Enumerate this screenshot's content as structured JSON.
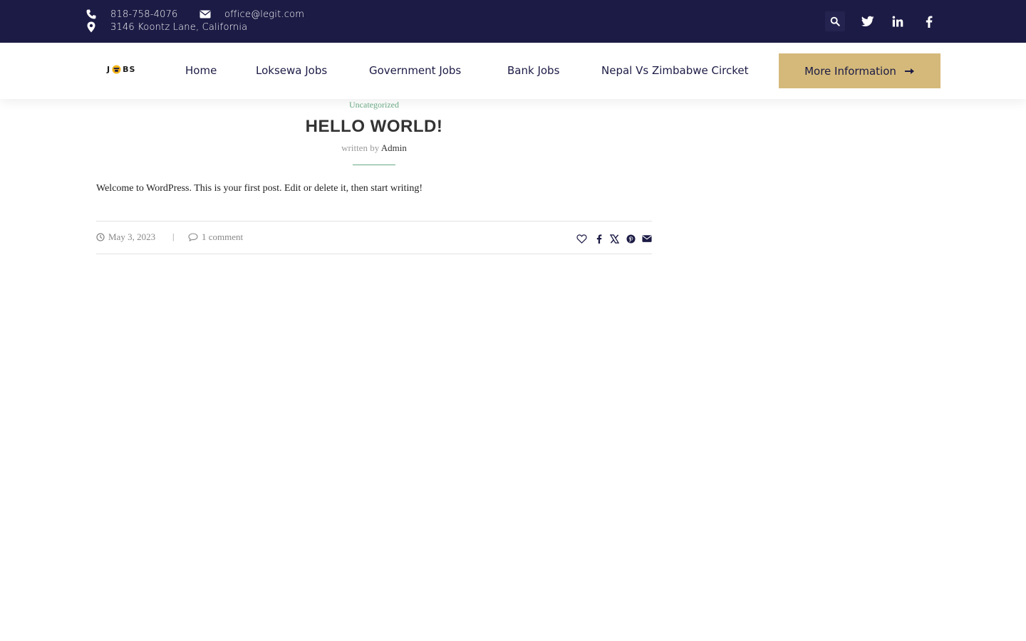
{
  "topbar": {
    "phone": "818-758-4076",
    "email": "office@legit.com",
    "address": "3146 Koontz Lane, California",
    "icons": [
      "phone-icon",
      "envelope-icon",
      "map-marker-icon",
      "search-icon",
      "twitter-icon",
      "linkedin-icon",
      "facebook-icon"
    ]
  },
  "nav": {
    "logo_left": "J",
    "logo_right": "BS",
    "items": [
      "Home",
      "Loksewa Jobs",
      "Government Jobs",
      "Bank Jobs",
      "Nepal Vs Zimbabwe Circket"
    ],
    "cta": "More Information"
  },
  "post": {
    "category": "Uncategorized",
    "title": "HELLO WORLD!",
    "written_by": "written by",
    "author": "Admin",
    "content": "Welcome to WordPress. This is your first post. Edit or delete it, then start writing!",
    "date": "May 3, 2023",
    "separator": "|",
    "comments": "1 comment",
    "share_icons": [
      "heart-icon",
      "facebook-icon",
      "x-icon",
      "pinterest-icon",
      "envelope-icon"
    ]
  },
  "colors": {
    "topbar_bg": "#1c1b45",
    "cta_bg": "#d4b97a",
    "accent_green": "#6aa983",
    "logo_yellow": "#f2b418"
  }
}
